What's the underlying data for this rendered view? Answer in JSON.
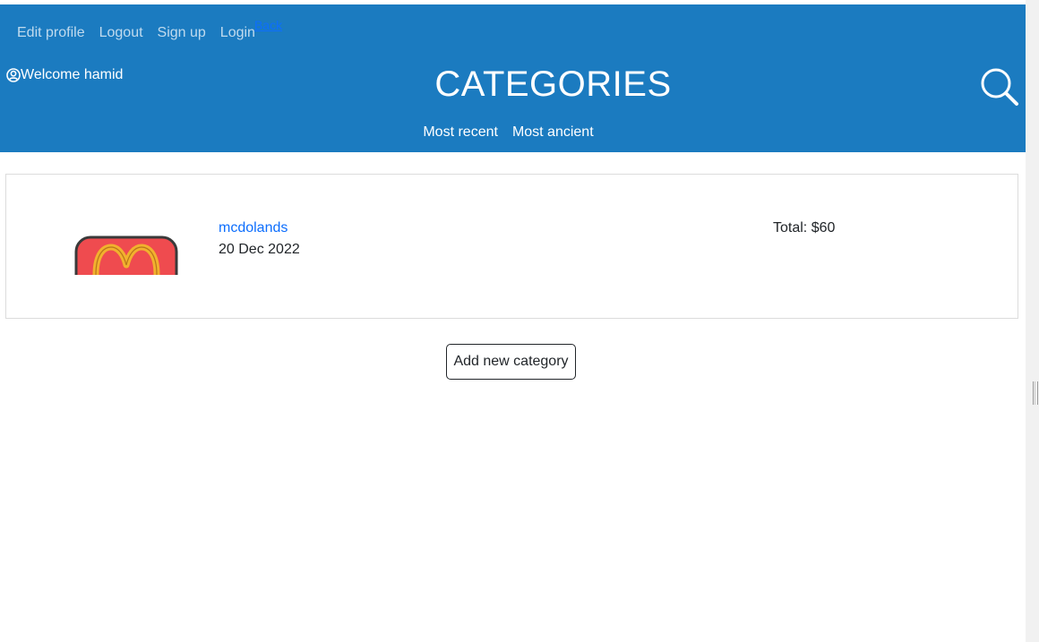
{
  "nav": {
    "links": [
      "Edit profile",
      "Logout",
      "Sign up",
      "Login"
    ],
    "back": "Back"
  },
  "header": {
    "welcome": "Welcome hamid",
    "title": "CATEGORIES",
    "user_icon": "user-circle-icon",
    "search_icon": "search-icon",
    "background_color": "#1b7bc0"
  },
  "sort": {
    "most_recent": "Most recent",
    "most_ancient": "Most ancient"
  },
  "categories": [
    {
      "name": "mcdolands",
      "date": "20 Dec 2022",
      "total": "Total: $60",
      "thumbnail_icon": "mcdonalds-logo-icon"
    }
  ],
  "actions": {
    "add_new_category": "Add new category"
  },
  "colors": {
    "link": "#0d6efd",
    "logo_red": "#ef4b4f",
    "logo_yellow": "#f2b12e"
  }
}
